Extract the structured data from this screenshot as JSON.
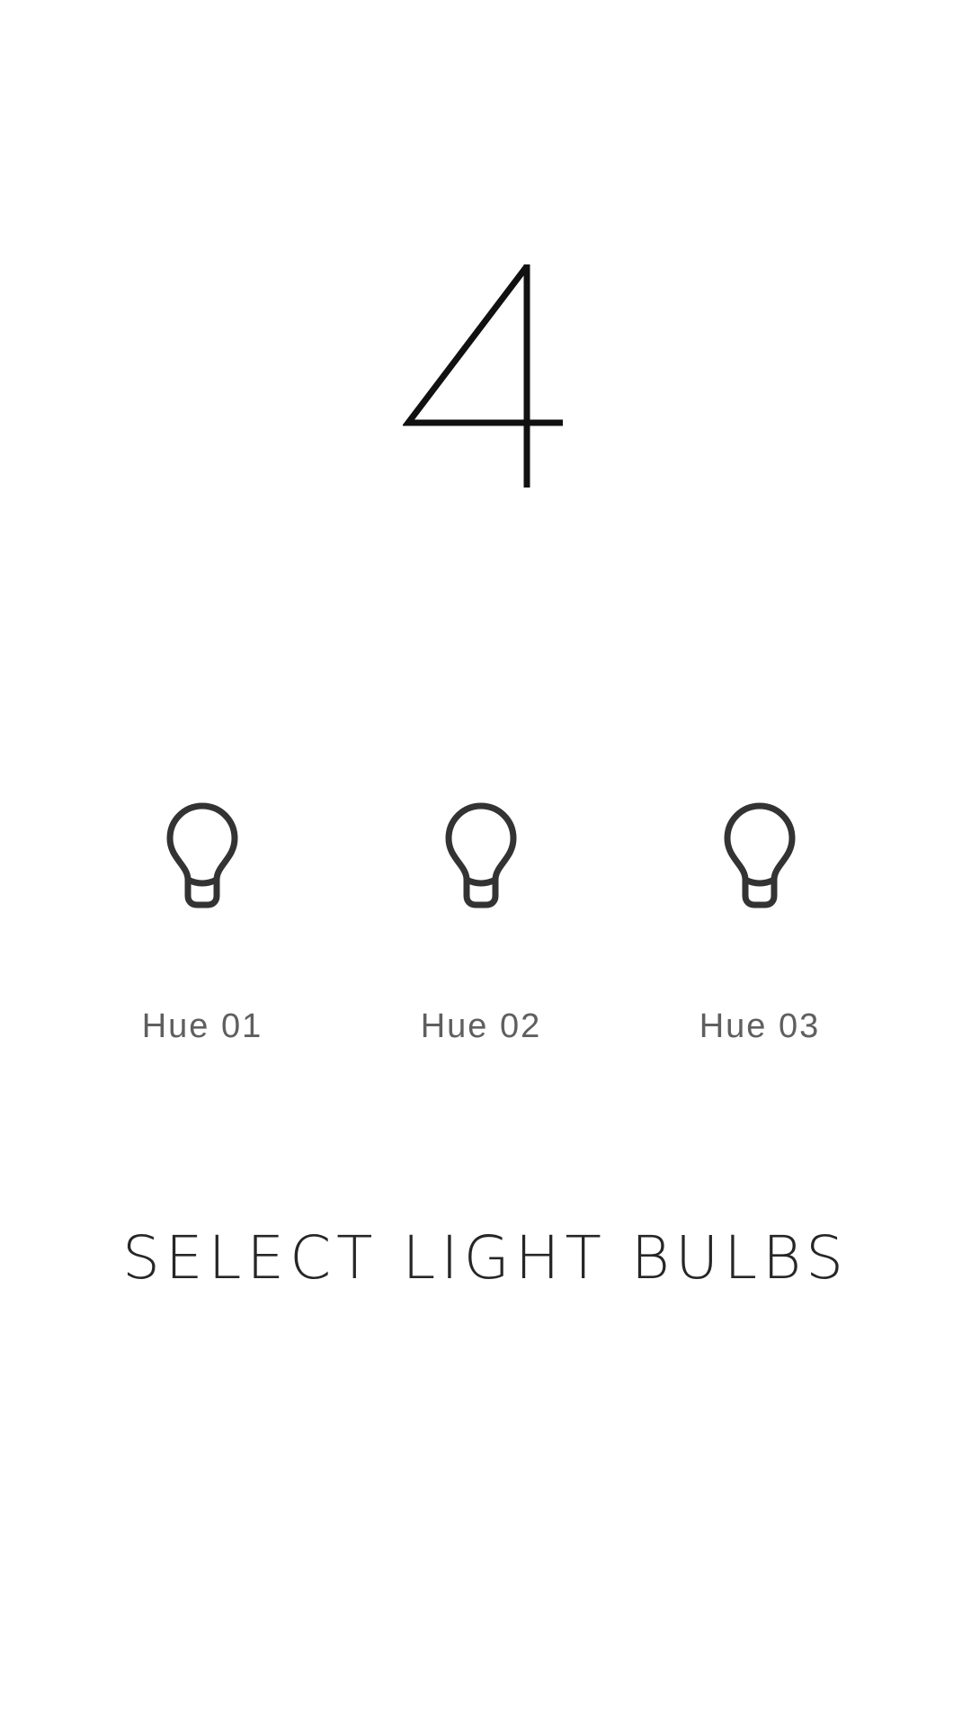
{
  "step": {
    "number": "4"
  },
  "bulbs": [
    {
      "label": "Hue 01",
      "icon": "lightbulb-icon"
    },
    {
      "label": "Hue 02",
      "icon": "lightbulb-icon"
    },
    {
      "label": "Hue 03",
      "icon": "lightbulb-icon"
    }
  ],
  "title": "SELECT LIGHT BULBS",
  "colors": {
    "background": "#ffffff",
    "number": "#111111",
    "icon": "#333333",
    "label": "#5f5f5f",
    "title": "#262626"
  }
}
